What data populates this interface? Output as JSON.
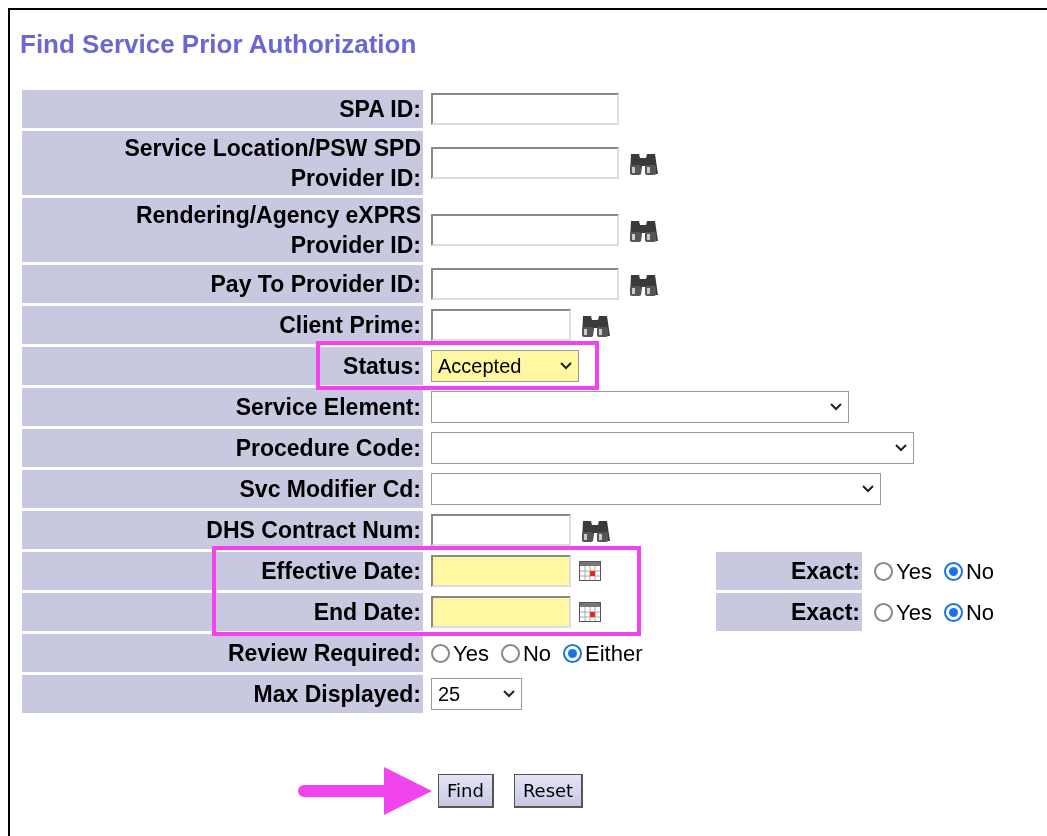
{
  "title": "Find Service Prior Authorization",
  "fields": [
    {
      "kind": "text",
      "label": "SPA ID:"
    },
    {
      "kind": "lookup",
      "label": "Service Location/PSW SPD Provider ID:"
    },
    {
      "kind": "lookup",
      "label": "Rendering/Agency eXPRS Provider ID:"
    },
    {
      "kind": "lookup",
      "label": "Pay To Provider ID:"
    },
    {
      "kind": "lookup",
      "label": "Client Prime:"
    },
    {
      "kind": "select",
      "label": "Status:",
      "value": "Accepted",
      "required": true,
      "highlight": true
    },
    {
      "kind": "select",
      "label": "Service Element:"
    },
    {
      "kind": "select",
      "label": "Procedure Code:"
    },
    {
      "kind": "select",
      "label": "Svc Modifier Cd:"
    },
    {
      "kind": "lookup",
      "label": "DHS Contract Num:"
    },
    {
      "kind": "date",
      "label": "Effective Date:",
      "required": true,
      "highlight": true,
      "exact_label": "Exact:",
      "exact": [
        {
          "label": "Yes",
          "selected": false
        },
        {
          "label": "No",
          "selected": true
        }
      ]
    },
    {
      "kind": "date",
      "label": "End Date:",
      "required": true,
      "highlight": true,
      "exact_label": "Exact:",
      "exact": [
        {
          "label": "Yes",
          "selected": false
        },
        {
          "label": "No",
          "selected": true
        }
      ]
    },
    {
      "kind": "radio",
      "label": "Review Required:",
      "options": [
        {
          "label": "Yes",
          "selected": false
        },
        {
          "label": "No",
          "selected": false
        },
        {
          "label": "Either",
          "selected": true
        }
      ]
    },
    {
      "kind": "select",
      "label": "Max Displayed:",
      "value": "25"
    }
  ],
  "buttons": [
    {
      "label": "Find",
      "pointed": true
    },
    {
      "label": "Reset",
      "pointed": false
    }
  ]
}
